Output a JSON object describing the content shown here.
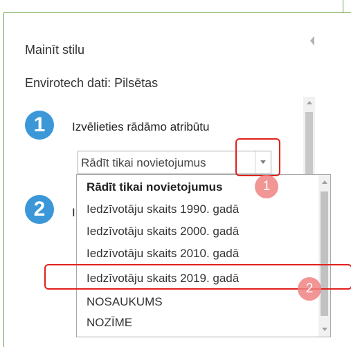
{
  "panel": {
    "title": "Mainīt stilu",
    "layer_name": "Envirotech dati: Pilsētas"
  },
  "step1": {
    "number": "1",
    "label": "Izvēlieties rādāmo atribūtu"
  },
  "step2": {
    "number": "2",
    "label": "I"
  },
  "select": {
    "selected": "Rādīt tikai novietojumus"
  },
  "dropdown": {
    "options": [
      "Rādīt tikai novietojumus",
      "Iedzīvotāju skaits 1990. gadā",
      "Iedzīvotāju skaits 2000. gadā",
      "Iedzīvotāju skaits 2010. gadā",
      "Iedzīvotāju skaits 2019. gadā",
      "NOSAUKUMS",
      "NOZĪME"
    ]
  },
  "annotations": {
    "marker1": "1",
    "marker2": "2"
  },
  "colors": {
    "step_circle": "#3b97d8",
    "highlight": "#e0201c",
    "panel_border": "#6fa34f"
  }
}
